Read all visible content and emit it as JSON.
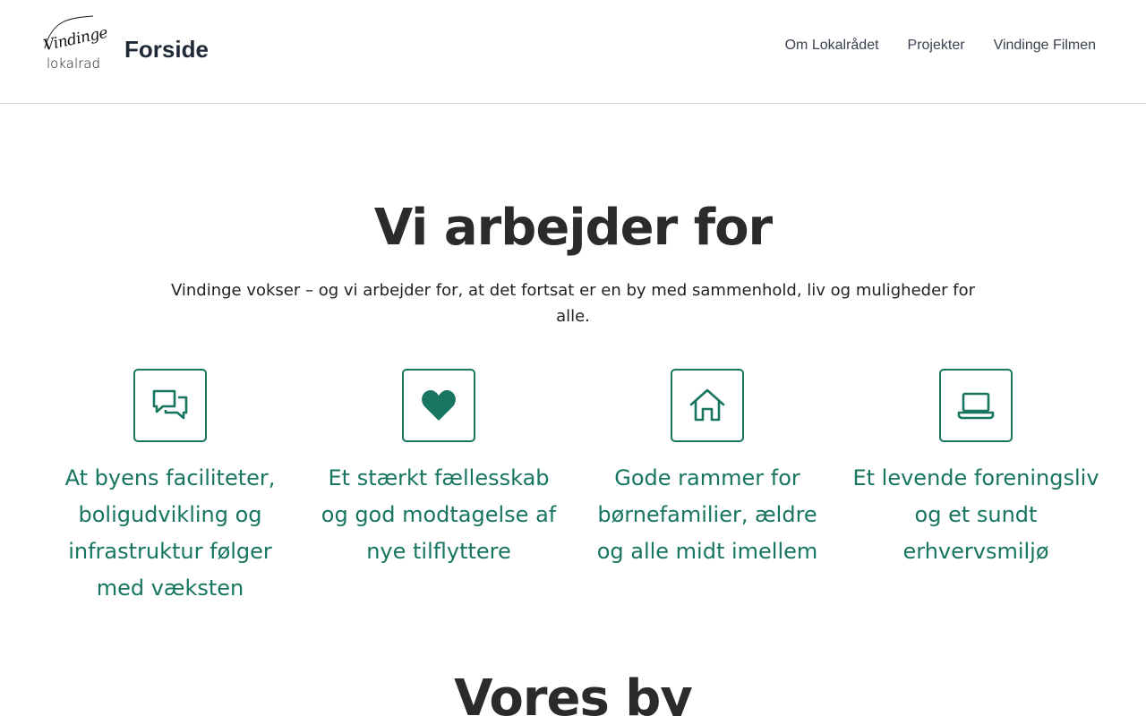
{
  "header": {
    "logo_script": "Vindinge",
    "logo_word": "lokalrad",
    "site_title": "Forside",
    "nav": [
      "Om Lokalrådet",
      "Projekter",
      "Vindinge Filmen"
    ]
  },
  "hero": {
    "title": "Vi arbejder for",
    "text": "Vindinge vokser – og vi arbejder for, at det fortsat er en by med sammenhold, liv og muligheder for alle."
  },
  "features": [
    {
      "icon": "chat-bubbles-icon",
      "title": "At byens faciliteter, boligudvikling og infrastruktur følger med væksten"
    },
    {
      "icon": "heart-icon",
      "title": "Et stærkt fællesskab og god modtagelse af nye tilflyttere"
    },
    {
      "icon": "house-icon",
      "title": "Gode rammer for børnefamilier, ældre og alle midt imellem"
    },
    {
      "icon": "laptop-icon",
      "title": "Et levende foreningsliv og et sundt erhvervsmiljø"
    }
  ],
  "next_section": {
    "title": "Vores by"
  },
  "colors": {
    "accent": "#177560",
    "text": "#2b2b2b",
    "divider": "#d9d9d9"
  }
}
